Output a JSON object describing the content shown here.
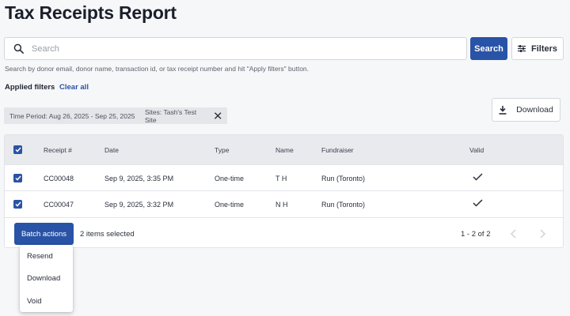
{
  "page": {
    "title": "Tax Receipts Report"
  },
  "search": {
    "placeholder": "Search",
    "button_label": "Search",
    "filters_label": "Filters",
    "hint": "Search by donor email, donor name, transaction id, or tax receipt number and hit \"Apply filters\" button."
  },
  "applied_filters": {
    "label": "Applied filters",
    "clear_all": "Clear all",
    "chips": [
      "Time Period: Aug 26, 2025 - Sep 25, 2025",
      "Sites: Tash's Test Site"
    ]
  },
  "download_button": "Download",
  "table": {
    "columns": [
      "Receipt #",
      "Date",
      "Type",
      "Name",
      "Fundraiser",
      "Valid"
    ],
    "rows": [
      {
        "receipt": "CC00048",
        "date": "Sep 9, 2025, 3:35 PM",
        "type": "One-time",
        "name": "T H",
        "fundraiser": "Run (Toronto)",
        "valid": true
      },
      {
        "receipt": "CC00047",
        "date": "Sep 9, 2025, 3:32 PM",
        "type": "One-time",
        "name": "N H",
        "fundraiser": "Run (Toronto)",
        "valid": true
      }
    ]
  },
  "footer": {
    "batch_label": "Batch actions",
    "selected_text": "2 items selected",
    "range_text": "1 - 2 of 2"
  },
  "batch_menu": {
    "items": [
      "Resend",
      "Download",
      "Void"
    ]
  },
  "colors": {
    "accent": "#2953a6",
    "background": "#f6f7f9",
    "table_header": "#e8eaee"
  },
  "icons": {
    "search": "search-icon",
    "filters": "sliders-icon",
    "chip_remove": "close-icon",
    "download": "download-icon",
    "checkbox": "checkbox-checked-icon",
    "valid": "checkmark-icon",
    "prev": "chevron-left-icon",
    "next": "chevron-right-icon"
  }
}
